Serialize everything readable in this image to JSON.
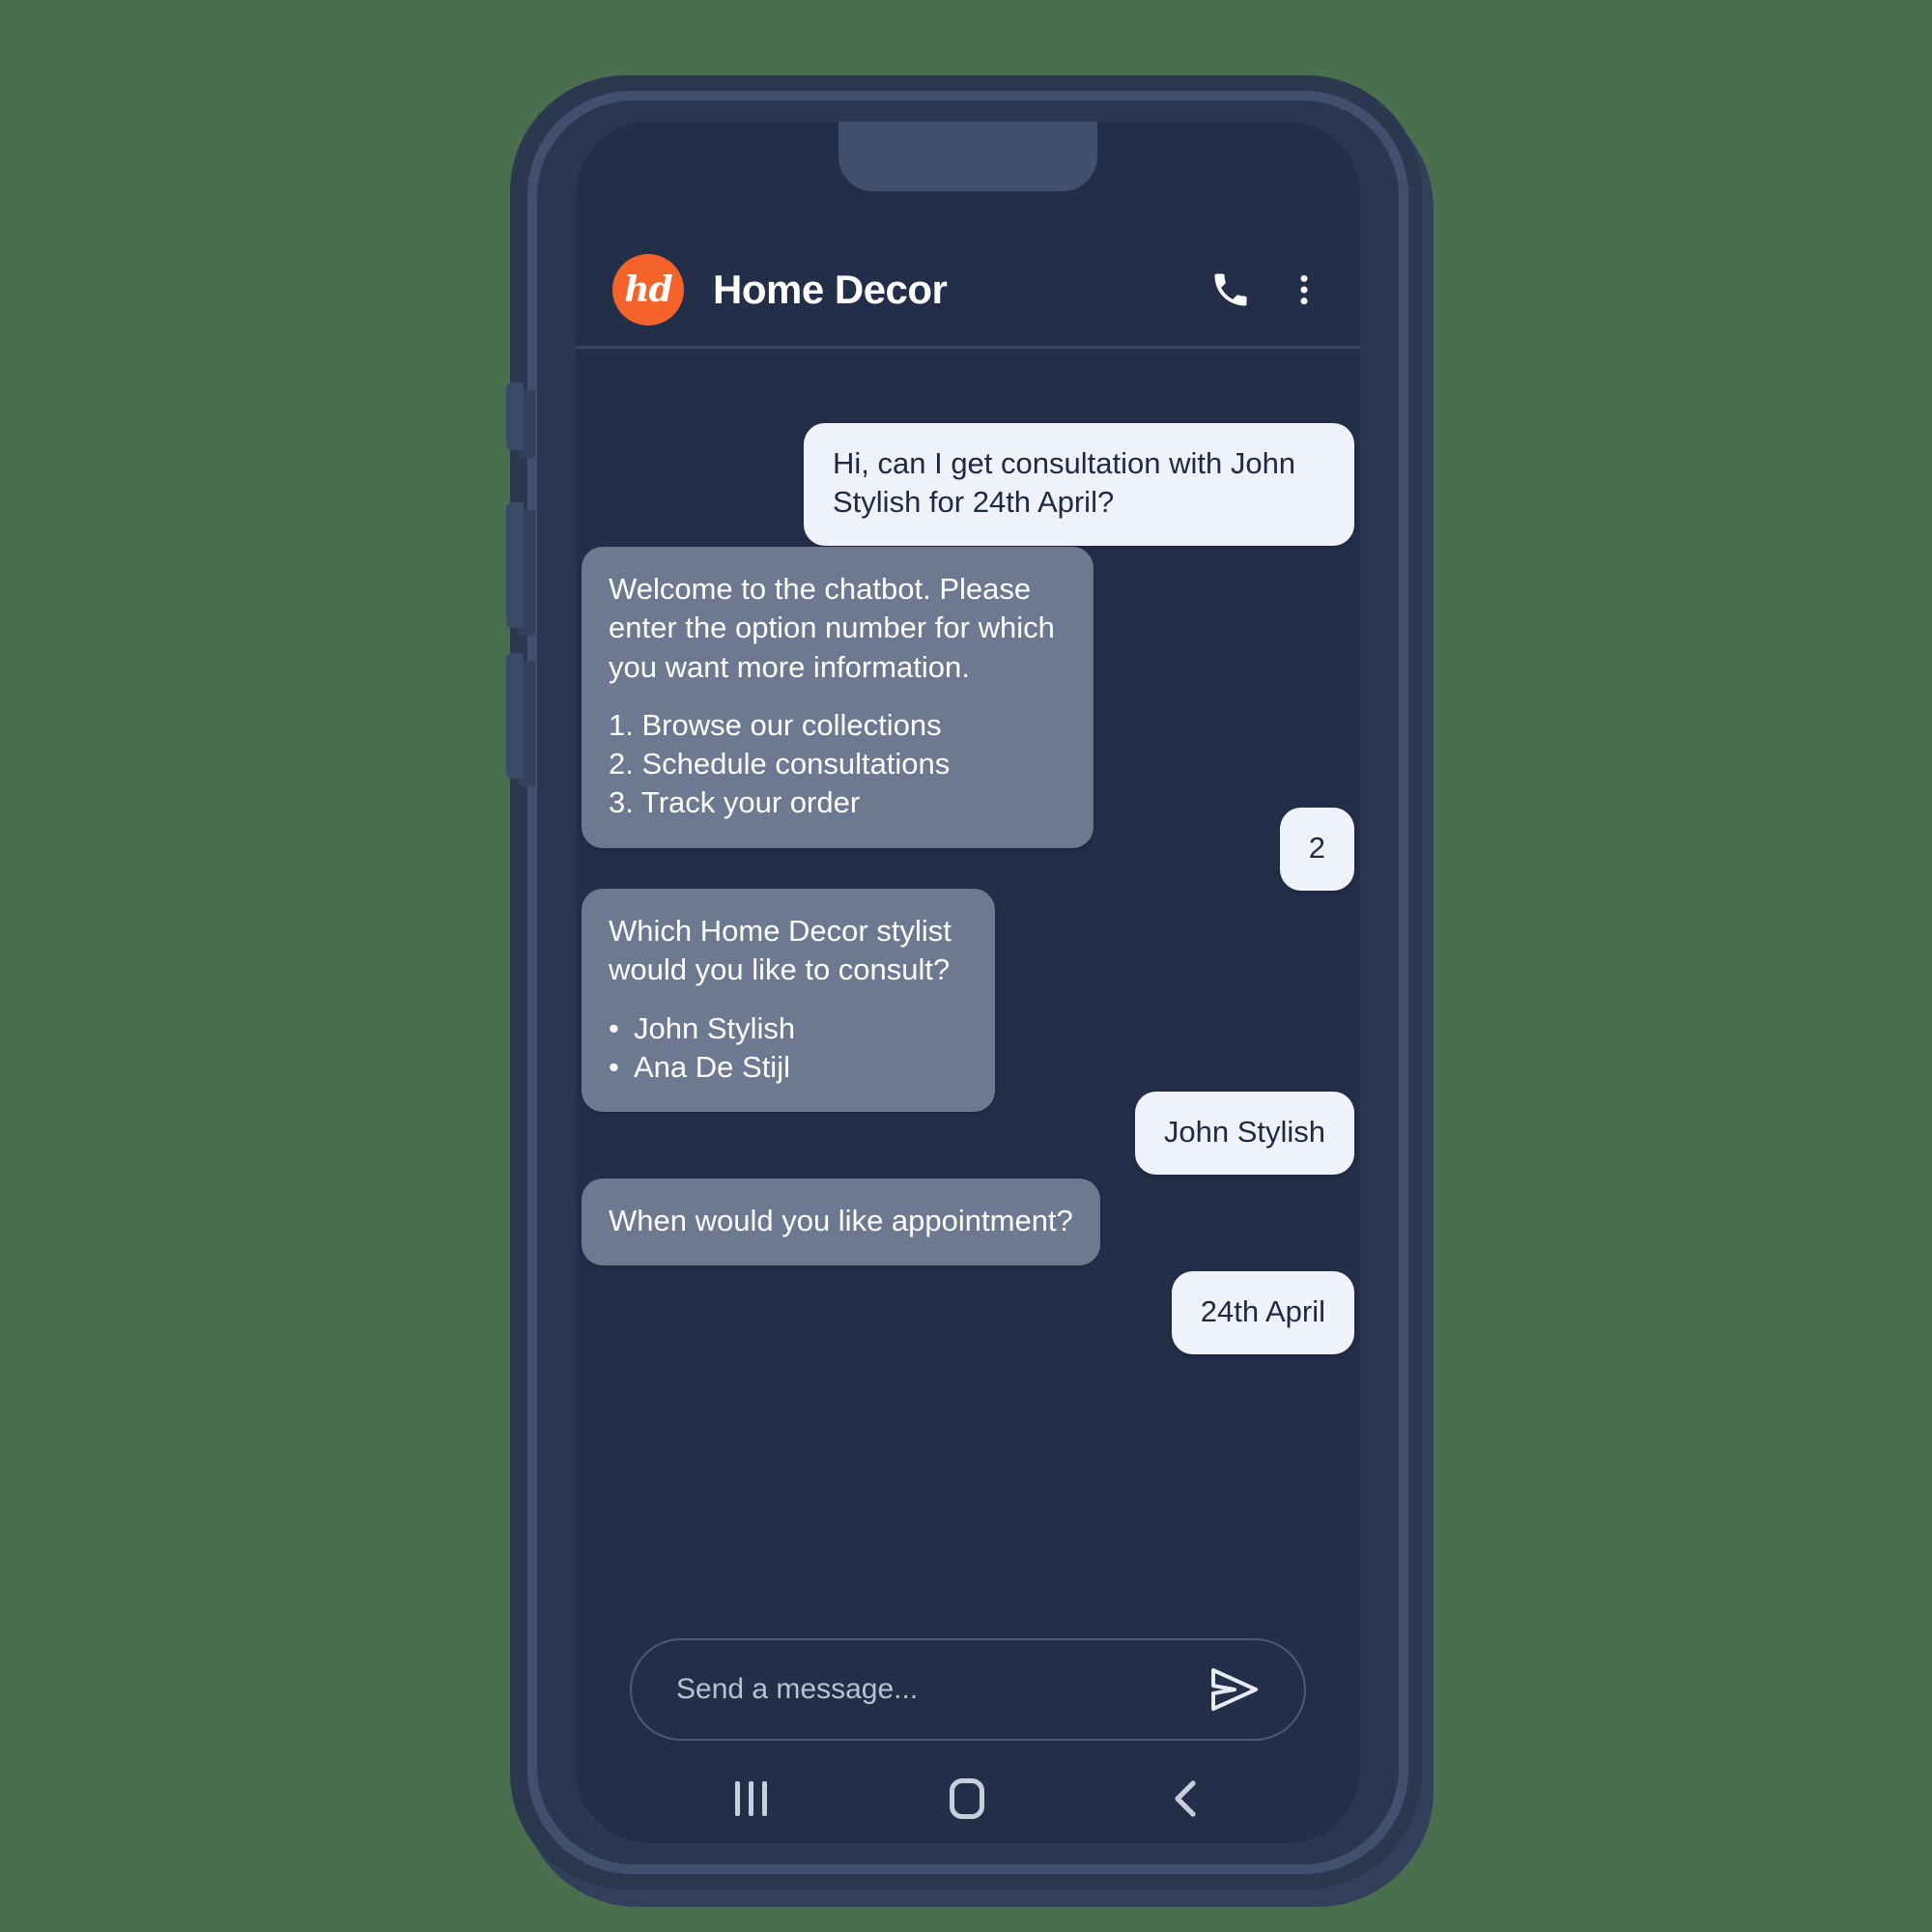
{
  "colors": {
    "page_background": "#4a6f4f",
    "phone_frame": "#2c3850",
    "phone_rim": "#41506f",
    "screen_background": "#232e48",
    "bot_bubble": "#6c7991",
    "user_bubble": "#eff2f9",
    "user_bubble_text": "#1e2a44",
    "accent_orange": "#f4642a",
    "nav_icon": "#c8cfdc"
  },
  "header": {
    "avatar_initials": "hd",
    "avatar_icon_name": "home-decor-logo",
    "title": "Home Decor",
    "call_icon": "phone-icon",
    "menu_icon": "more-vertical-icon"
  },
  "chat": {
    "messages": [
      {
        "id": "m1",
        "sender": "user",
        "text": "Hi, can I get consultation with John Stylish for 24th April?"
      },
      {
        "id": "m2",
        "sender": "bot",
        "text": "Welcome to the chatbot. Please enter the option number for which you want more information.",
        "options": [
          "1. Browse our collections",
          "2. Schedule consultations",
          "3. Track your order"
        ]
      },
      {
        "id": "m3",
        "sender": "user",
        "text": "2"
      },
      {
        "id": "m4",
        "sender": "bot",
        "text": "Which Home Decor stylist would you like to consult?",
        "bullets": [
          "John Stylish",
          "Ana De Stijl"
        ]
      },
      {
        "id": "m5",
        "sender": "user",
        "text": "John Stylish"
      },
      {
        "id": "m6",
        "sender": "bot",
        "text": "When would you like appointment?"
      },
      {
        "id": "m7",
        "sender": "user",
        "text": "24th April"
      }
    ]
  },
  "composer": {
    "placeholder": "Send a message...",
    "send_icon": "send-arrow-icon"
  },
  "navigation": {
    "recents_icon": "recents-icon",
    "home_icon": "home-icon",
    "back_icon": "back-chevron-icon"
  }
}
